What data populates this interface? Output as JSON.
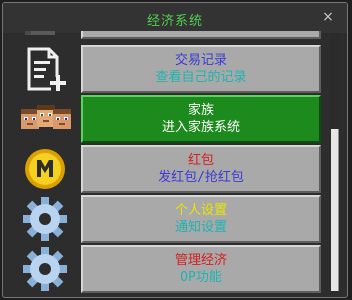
{
  "window": {
    "title": "经济系统",
    "close_glyph": "×"
  },
  "colors": {
    "title": "#4fd14f",
    "blue_text": "#3a3ad6",
    "cyan_text": "#1fb3b3",
    "red_text": "#d42020",
    "yellow_text": "#e6e600",
    "white_text": "#ffffff",
    "active_button": "#1d8a1d",
    "button": "#a9a9a9"
  },
  "items": [
    {
      "line1": "交易记录",
      "line2": "查看自己的记录",
      "icon": "document-add-icon"
    },
    {
      "line1": "家族",
      "line2": "进入家族系统",
      "icon": "villager-faces-icon",
      "active": true
    },
    {
      "line1": "红包",
      "line2": "发红包/抢红包",
      "icon": "gold-m-coin-icon"
    },
    {
      "line1": "个人设置",
      "line2": "通知设置",
      "icon": "gear-icon"
    },
    {
      "line1": "管理经济",
      "line2": "OP功能",
      "icon": "gear-icon"
    }
  ]
}
